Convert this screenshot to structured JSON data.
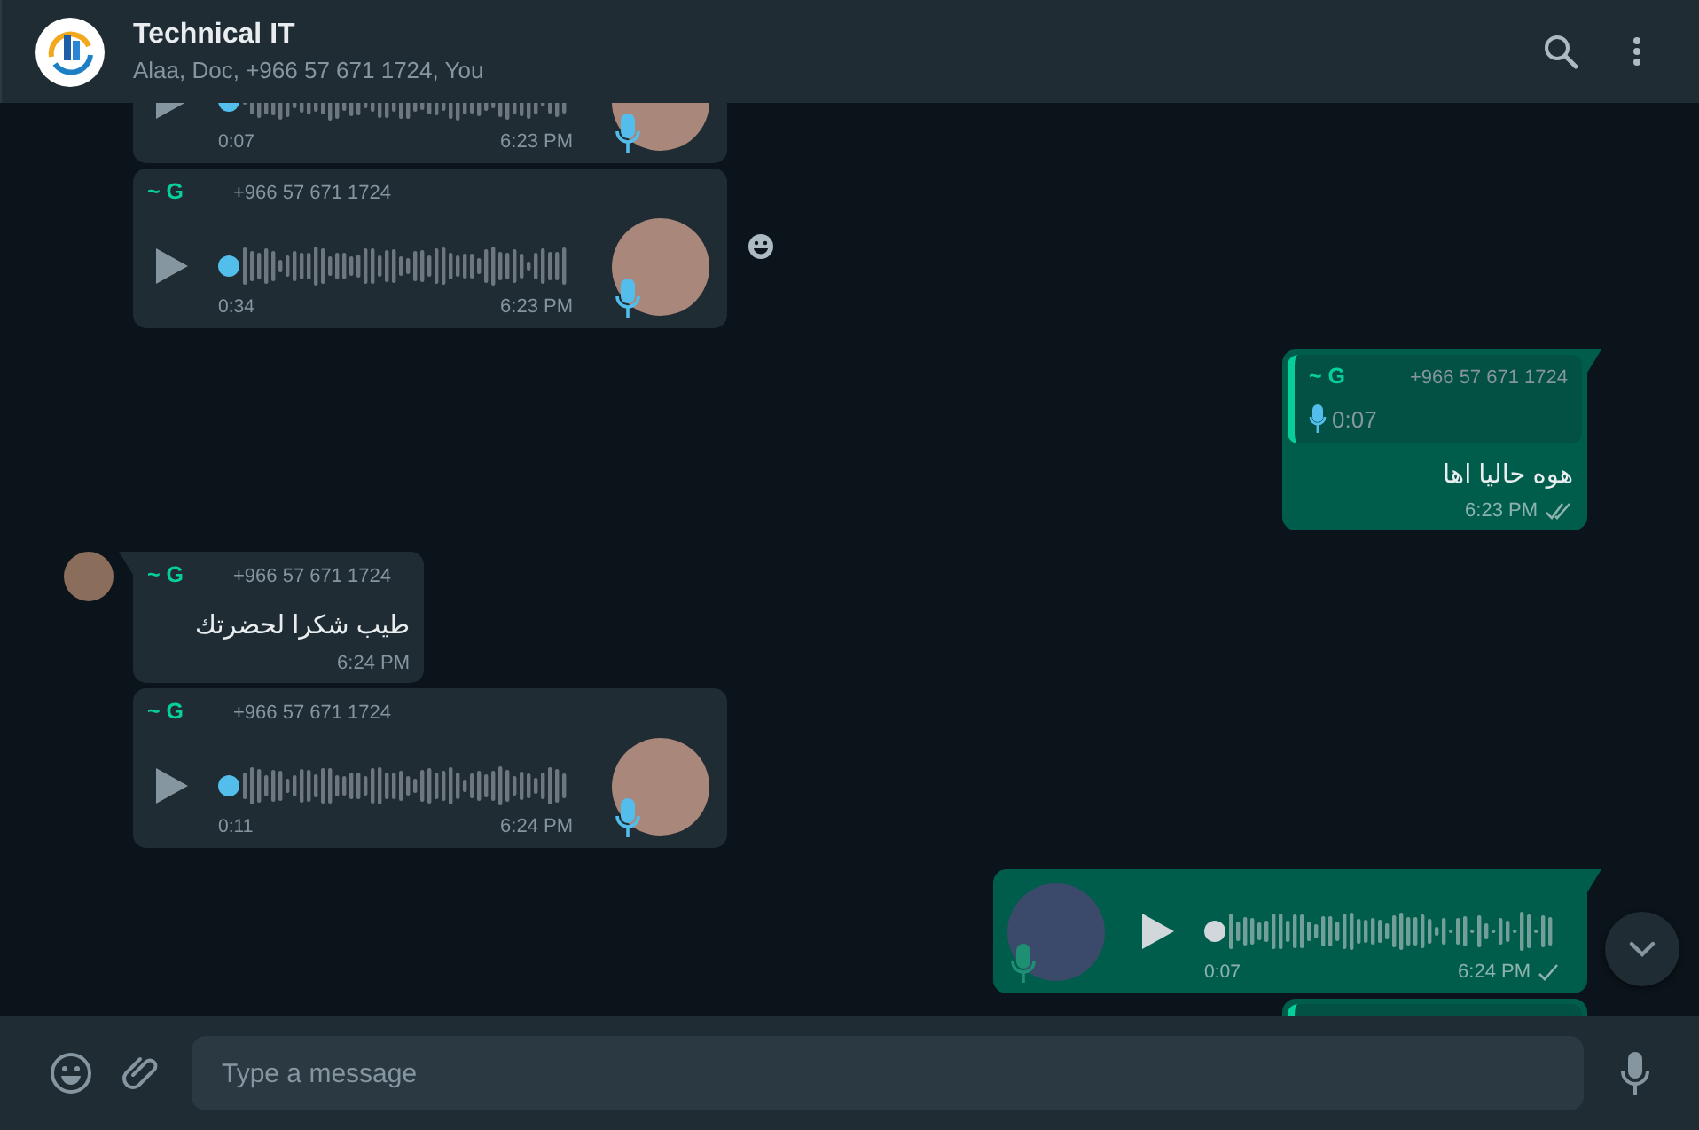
{
  "header": {
    "title": "Technical IT",
    "subtitle": "Alaa, Doc, +966 57 671 1724, You"
  },
  "messages": [
    {
      "kind": "voice",
      "outgoing": false,
      "tail": false,
      "avatar": false,
      "played": true,
      "duration": "0:07",
      "time": "6:23 PM",
      "reaction_button": false
    },
    {
      "kind": "voice",
      "outgoing": false,
      "tail": false,
      "avatar": false,
      "played": true,
      "sender": "~ G",
      "phone": "+966 57 671 1724",
      "duration": "0:34",
      "time": "6:23 PM",
      "reaction_button": true
    },
    {
      "kind": "quote",
      "outgoing": true,
      "tail": true,
      "quote": {
        "sender": "~ G",
        "phone": "+966 57 671 1724",
        "duration": "0:07"
      },
      "text": "هوه حاليا اها",
      "time": "6:23 PM",
      "delivered": true
    },
    {
      "kind": "text",
      "outgoing": false,
      "tail": true,
      "avatar": true,
      "sender": "~ G",
      "phone": "+966 57 671 1724",
      "text": "طيب شكرا لحضرتك",
      "time": "6:24 PM"
    },
    {
      "kind": "voice",
      "outgoing": false,
      "tail": false,
      "avatar": false,
      "played": true,
      "sender": "~ G",
      "phone": "+966 57 671 1724",
      "duration": "0:11",
      "time": "6:24 PM",
      "reaction_button": false
    },
    {
      "kind": "voice",
      "outgoing": true,
      "tail": true,
      "played": false,
      "duration": "0:07",
      "time": "6:24 PM",
      "delivered": false,
      "reaction_button": false
    },
    {
      "kind": "quote",
      "outgoing": true,
      "tail": false
    }
  ],
  "composer": {
    "placeholder": "Type a message"
  }
}
